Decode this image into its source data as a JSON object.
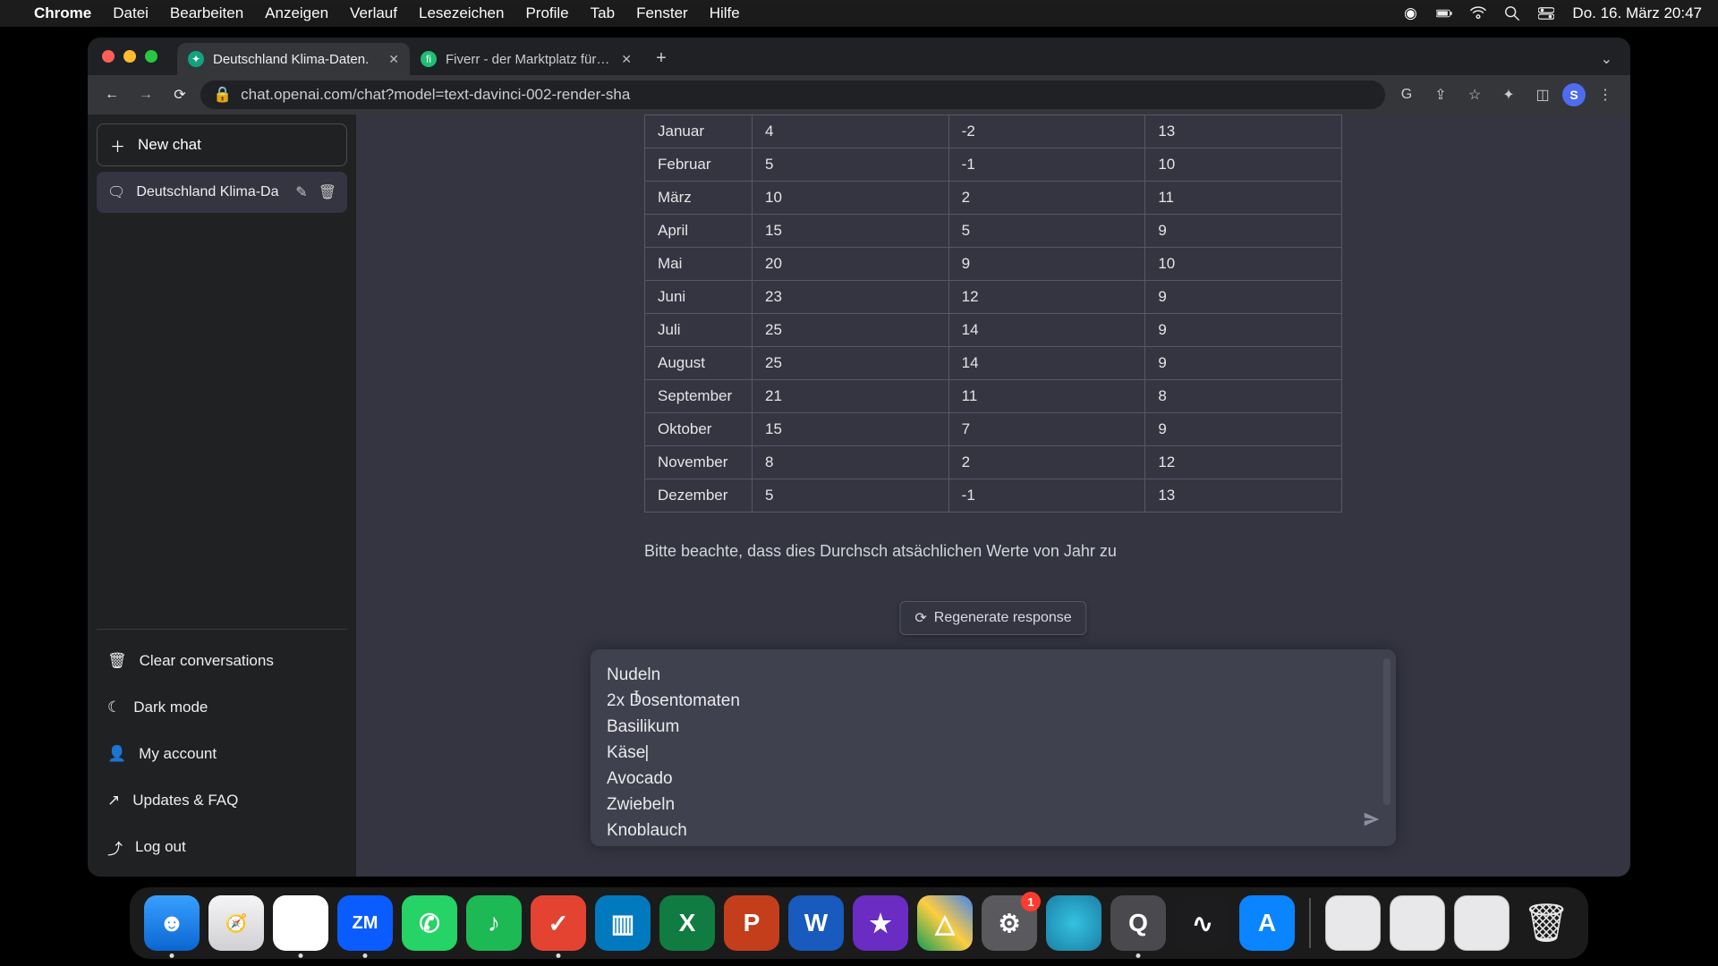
{
  "menubar": {
    "app": "Chrome",
    "items": [
      "Datei",
      "Bearbeiten",
      "Anzeigen",
      "Verlauf",
      "Lesezeichen",
      "Profile",
      "Tab",
      "Fenster",
      "Hilfe"
    ],
    "datetime": "Do. 16. März  20:47"
  },
  "chrome": {
    "tabs": [
      {
        "title": "Deutschland Klima-Daten.",
        "active": true,
        "favicon_bg": "#10a37f",
        "favicon_text": "✦"
      },
      {
        "title": "Fiverr - der Marktplatz für Fre…",
        "active": false,
        "favicon_bg": "#1dbf73",
        "favicon_text": "fi"
      }
    ],
    "url": "chat.openai.com/chat?model=text-davinci-002-render-sha",
    "avatar_letter": "S",
    "avatar_bg": "#4e6cef"
  },
  "sidebar": {
    "new_chat": "New chat",
    "conversation": "Deutschland Klima-Da",
    "items": {
      "clear": "Clear conversations",
      "dark": "Dark mode",
      "account": "My account",
      "updates": "Updates & FAQ",
      "logout": "Log out"
    }
  },
  "table": {
    "rows": [
      {
        "m": "Januar",
        "a": "4",
        "b": "-2",
        "c": "13"
      },
      {
        "m": "Februar",
        "a": "5",
        "b": "-1",
        "c": "10"
      },
      {
        "m": "März",
        "a": "10",
        "b": "2",
        "c": "11"
      },
      {
        "m": "April",
        "a": "15",
        "b": "5",
        "c": "9"
      },
      {
        "m": "Mai",
        "a": "20",
        "b": "9",
        "c": "10"
      },
      {
        "m": "Juni",
        "a": "23",
        "b": "12",
        "c": "9"
      },
      {
        "m": "Juli",
        "a": "25",
        "b": "14",
        "c": "9"
      },
      {
        "m": "August",
        "a": "25",
        "b": "14",
        "c": "9"
      },
      {
        "m": "September",
        "a": "21",
        "b": "11",
        "c": "8"
      },
      {
        "m": "Oktober",
        "a": "15",
        "b": "7",
        "c": "9"
      },
      {
        "m": "November",
        "a": "8",
        "b": "2",
        "c": "12"
      },
      {
        "m": "Dezember",
        "a": "5",
        "b": "-1",
        "c": "13"
      }
    ]
  },
  "note": "Bitte beachte, dass dies Durchsch                                      atsächlichen Werte von Jahr zu",
  "regen": "Regenerate response",
  "input": {
    "lines": [
      "Nudeln",
      "2x Dosentomaten",
      "Basilikum",
      "Käse",
      "Avocado",
      "Zwiebeln",
      "Knoblauch"
    ]
  },
  "dock": {
    "apps": [
      {
        "name": "finder",
        "bg": "linear-gradient(#39a0ff,#0a66d1)",
        "glyph": "☻",
        "running": true
      },
      {
        "name": "safari",
        "bg": "linear-gradient(#f5f5f7,#d0d0d4)",
        "glyph": "🧭",
        "running": false
      },
      {
        "name": "chrome",
        "bg": "#fff",
        "glyph": "◉",
        "running": true
      },
      {
        "name": "zoom",
        "bg": "#0b5cff",
        "glyph": "ZM",
        "running": true
      },
      {
        "name": "whatsapp",
        "bg": "#25d366",
        "glyph": "✆",
        "running": false
      },
      {
        "name": "spotify",
        "bg": "#1db954",
        "glyph": "♪",
        "running": false
      },
      {
        "name": "todoist",
        "bg": "#e44332",
        "glyph": "✓",
        "running": true
      },
      {
        "name": "trello",
        "bg": "#0079bf",
        "glyph": "▥",
        "running": false
      },
      {
        "name": "excel",
        "bg": "#107c41",
        "glyph": "X",
        "running": false
      },
      {
        "name": "powerpoint",
        "bg": "#c43e1c",
        "glyph": "P",
        "running": false
      },
      {
        "name": "word",
        "bg": "#185abd",
        "glyph": "W",
        "running": false
      },
      {
        "name": "imovie",
        "bg": "#6a2cc3",
        "glyph": "★",
        "running": false
      },
      {
        "name": "drive",
        "bg": "linear-gradient(45deg,#0f9d58,#ffcd40,#4285f4)",
        "glyph": "△",
        "running": false
      },
      {
        "name": "settings",
        "bg": "#5a5a5e",
        "glyph": "⚙",
        "running": false,
        "badge": "1"
      },
      {
        "name": "siri",
        "bg": "radial-gradient(circle,#34c2e0,#1b7fa5)",
        "glyph": "",
        "running": false
      },
      {
        "name": "quicktime",
        "bg": "#4a4a4e",
        "glyph": "Q",
        "running": true
      },
      {
        "name": "voice",
        "bg": "#1c1c1e",
        "glyph": "∿",
        "running": false
      },
      {
        "name": "appstore",
        "bg": "#0a84ff",
        "glyph": "A",
        "running": false
      }
    ],
    "minis": 3
  }
}
